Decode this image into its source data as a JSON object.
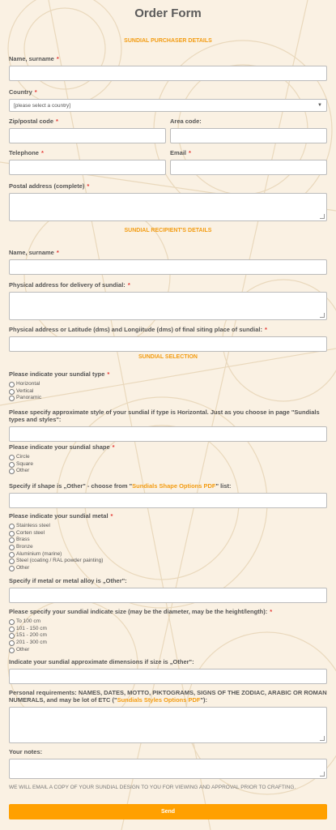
{
  "form": {
    "title": "Order Form",
    "sections": {
      "purchaser": "SUNDIAL PURCHASER DETAILS",
      "recipient": "SUNDIAL RECIPIENT'S DETAILS",
      "selection": "SUNDIAL SELECTION"
    },
    "purchaser": {
      "name_label": "Name, surname",
      "country_label": "Country",
      "country_value": "[please select a country]",
      "zip_label": "Zip/postal code",
      "area_label": "Area code:",
      "phone_label": "Telephone",
      "email_label": "Email",
      "postal_label": "Postal address (complete)"
    },
    "recipient": {
      "name_label": "Name, surname",
      "delivery_label": "Physical address for delivery of sundial:",
      "siting_label": "Physical address or Latitude (dms) and Longiitude (dms) of final siting place of sundial:"
    },
    "selection": {
      "type_label": "Please indicate your sundial type",
      "type_options": [
        "Horizontal",
        "Vertical",
        "Panoramic"
      ],
      "style_label": "Please specify approximate style of your sundial if type is Horizontal. Just as you choose in page \"Sundials types and styles\":",
      "shape_label": "Please indicate your sundial shape",
      "shape_options": [
        "Circle",
        "Square",
        "Other"
      ],
      "shape_other_prefix": "Specify if shape is „Other\" - choose from \"",
      "shape_other_link": "Sundials Shape Options PDF",
      "shape_other_suffix": "\" list:",
      "metal_label": "Please indicate your sundial metal",
      "metal_options": [
        "Stainless steel",
        "Corten steel",
        "Brass",
        "Bronze",
        "Aluminium (marine)",
        "Steel (coating / RAL powder painting)",
        "Other"
      ],
      "metal_other_label": "Specify if metal or metal alloy is „Other\":",
      "size_label": "Please specify your sundial indicate size (may be the diameter, may be the height/length):",
      "size_options": [
        "To 100 cm",
        "101 - 150 cm",
        "151 - 200 cm",
        "201 - 300 cm",
        "Other"
      ],
      "size_other_label": "Indicate your sundial approximate dimensions if size is „Other\":",
      "personal_prefix": "Personal requirements: NAMES, DATES, MOTTO, PIKTOGRAMS, SIGNS OF THE ZODIAC, ARABIC OR ROMAN NUMERALS, and may be lot of ETC (\"",
      "personal_link": "Sundials Styles Options PDF",
      "personal_suffix": "\"):",
      "notes_label": "Your notes:"
    },
    "footer_note": "WE WILL EMAIL A COPY OF YOUR SUNDIAL DESIGN TO YOU FOR VIEWING AND APPROVAL PRIOR TO CRAFTING.",
    "submit_label": "Send"
  }
}
